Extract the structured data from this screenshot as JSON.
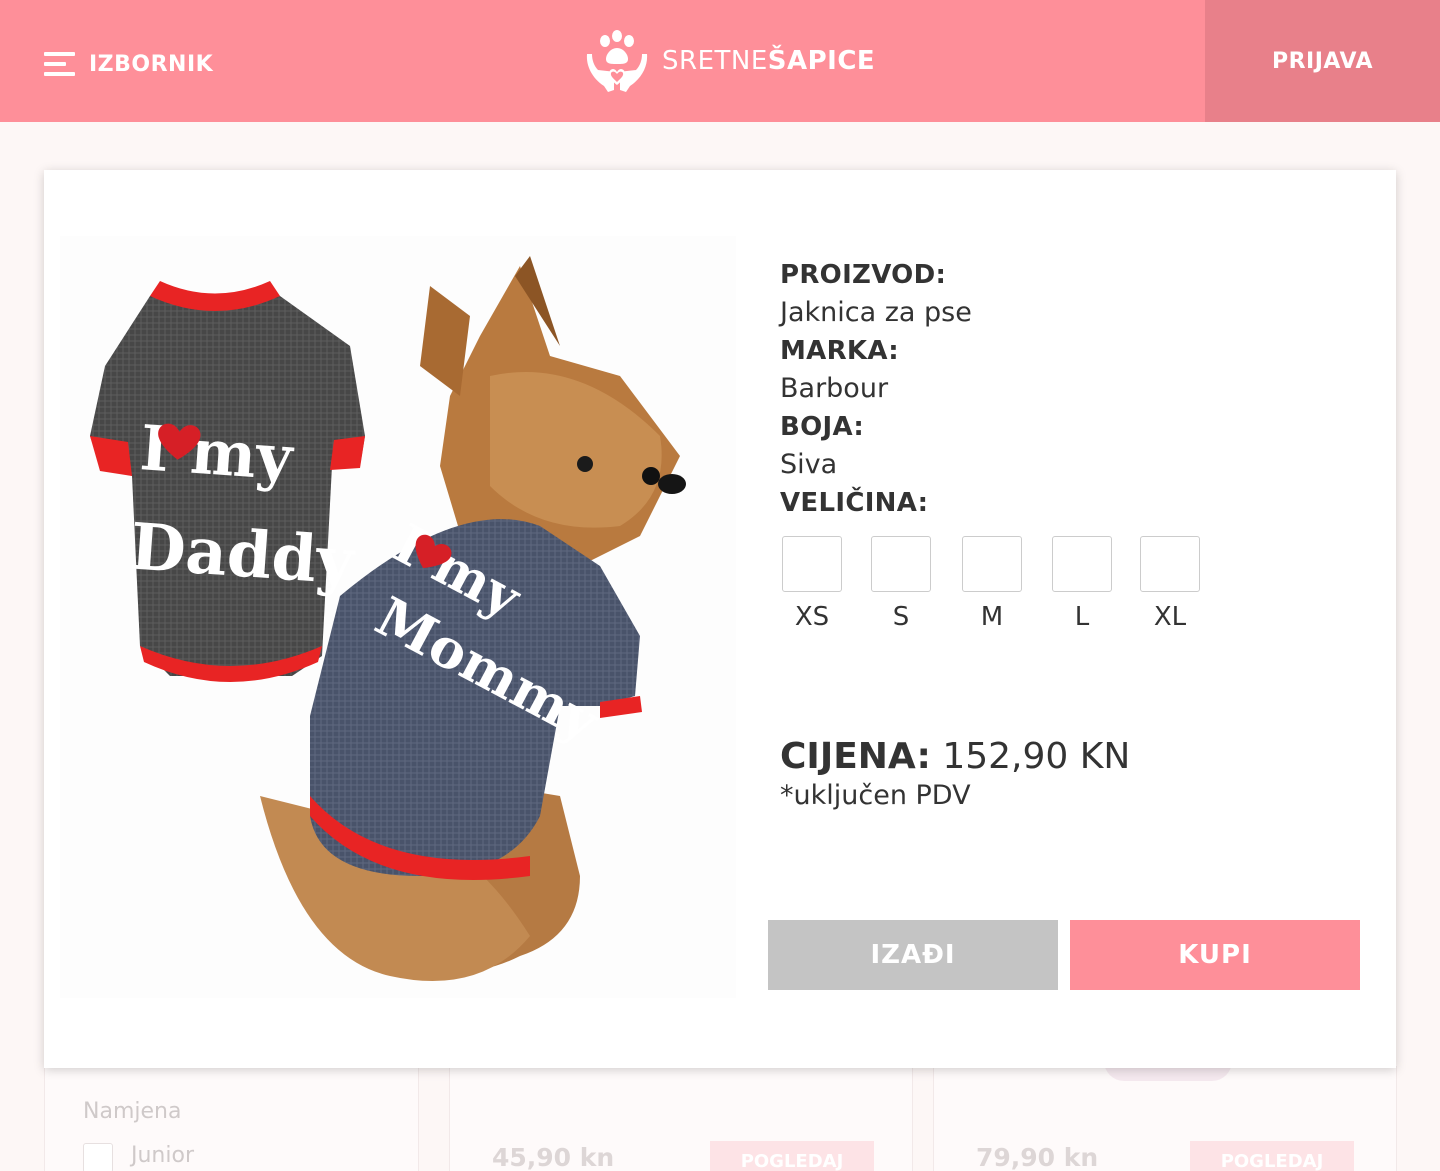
{
  "header": {
    "menu_label": "IZBORNIK",
    "logo_text_light": "SRETNE",
    "logo_text_bold": "ŠAPICE",
    "login_label": "PRIJAVA"
  },
  "background": {
    "filter_title": "Namjena",
    "filter_option": "Junior",
    "cards": [
      {
        "price": "45,90 kn",
        "button": "POGLEDAJ"
      },
      {
        "price": "79,90 kn",
        "button": "POGLEDAJ"
      }
    ]
  },
  "product": {
    "image_text": {
      "left_sweater": [
        "I ❤ my",
        "Daddy"
      ],
      "right_sweater": [
        "I ❤ my",
        "Mommy"
      ]
    },
    "product_label": "PROIZVOD:",
    "product_value": "Jaknica za pse",
    "brand_label": "MARKA:",
    "brand_value": "Barbour",
    "color_label": "BOJA:",
    "color_value": "Siva",
    "size_label": "VELIČINA:",
    "sizes": [
      "XS",
      "S",
      "M",
      "L",
      "XL"
    ],
    "price_label": "CIJENA:",
    "price_value": "152,90 KN",
    "vat_note": "*uključen PDV",
    "exit_button": "IZAĐI",
    "buy_button": "KUPI"
  },
  "colors": {
    "brand_pink": "#fe8f99",
    "login_bg": "#e8808a",
    "exit_gray": "#c4c4c4"
  }
}
